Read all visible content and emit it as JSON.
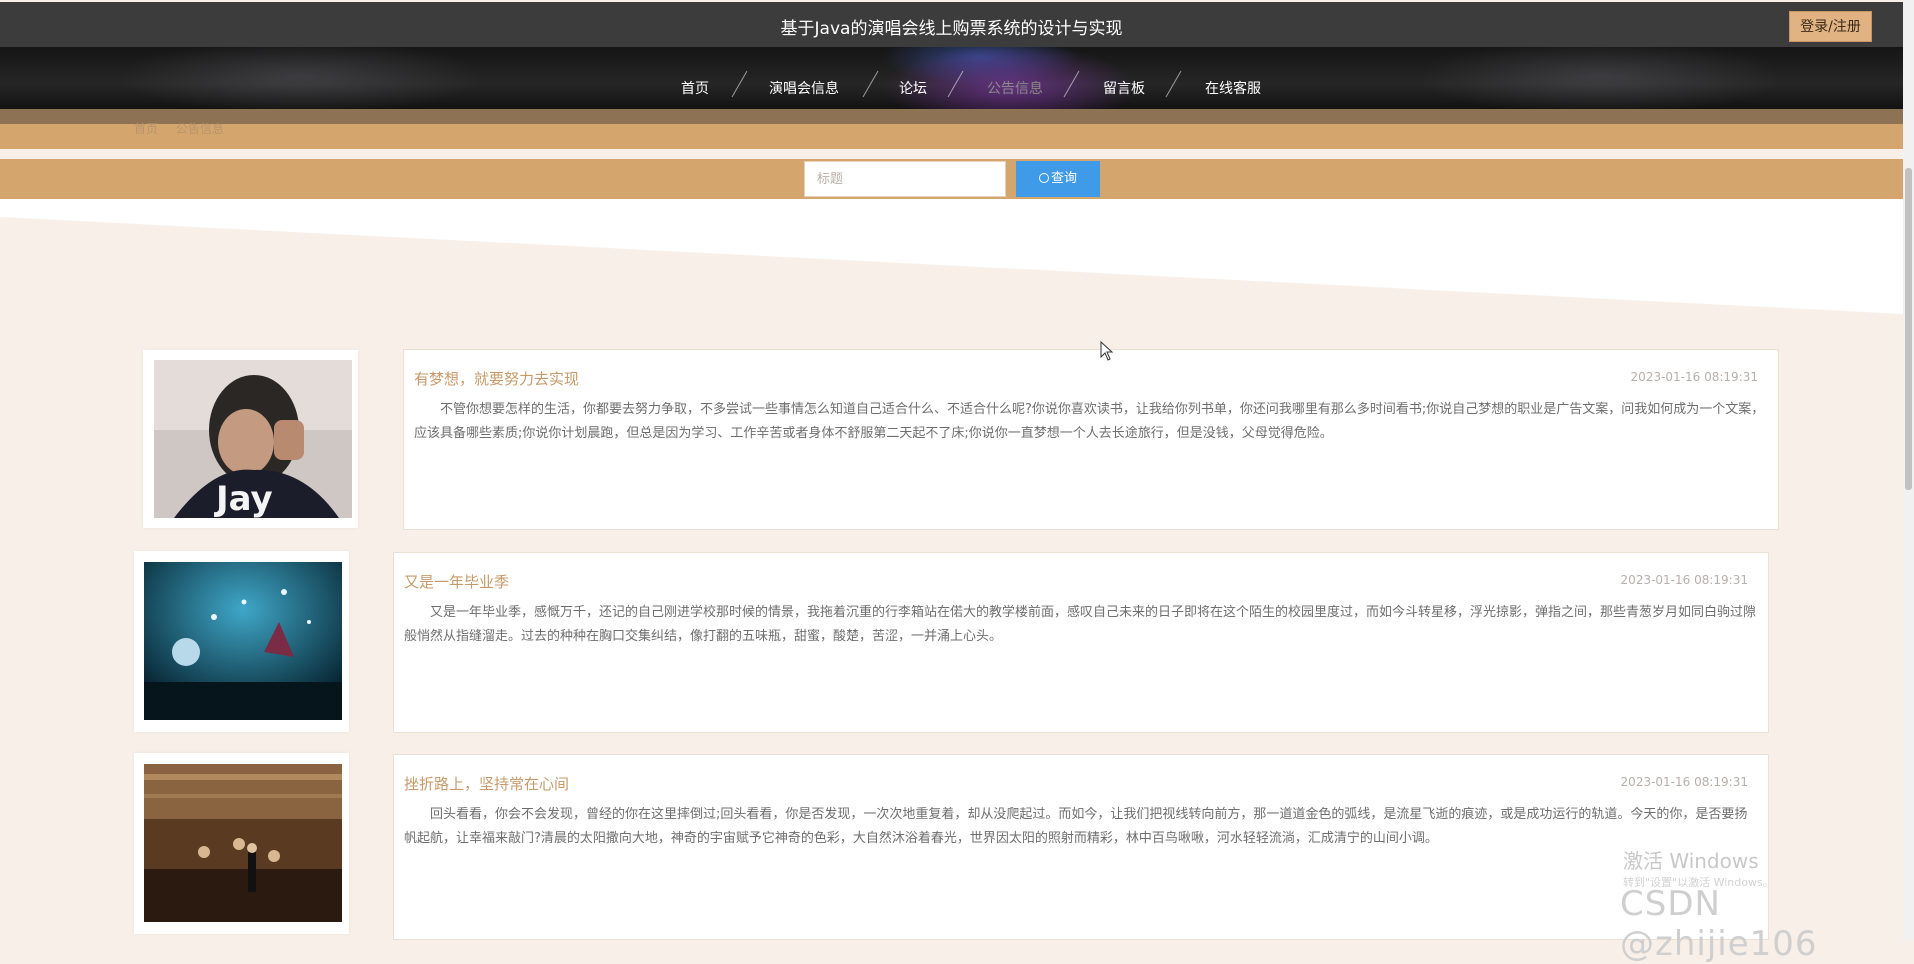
{
  "header": {
    "title": "基于Java的演唱会线上购票系统的设计与实现",
    "login_label": "登录/注册"
  },
  "nav": {
    "items": [
      {
        "label": "首页",
        "active": false
      },
      {
        "label": "演唱会信息",
        "active": false
      },
      {
        "label": "论坛",
        "active": false
      },
      {
        "label": "公告信息",
        "active": true
      },
      {
        "label": "留言板",
        "active": false
      },
      {
        "label": "在线客服",
        "active": false
      }
    ]
  },
  "breadcrumb": {
    "home": "首页",
    "current": "公告信息"
  },
  "search": {
    "placeholder": "标题",
    "button_label": "查询"
  },
  "articles": [
    {
      "title": "有梦想，就要努力去实现",
      "date": "2023-01-16 08:19:31",
      "image": "jay-portrait",
      "text": "不管你想要怎样的生活，你都要去努力争取，不多尝试一些事情怎么知道自己适合什么、不适合什么呢?你说你喜欢读书，让我给你列书单，你还问我哪里有那么多时间看书;你说自己梦想的职业是广告文案，问我如何成为一个文案，应该具备哪些素质;你说你计划晨跑，但总是因为学习、工作辛苦或者身体不舒服第二天起不了床;你说你一直梦想一个人去长途旅行，但是没钱，父母觉得危险。"
    },
    {
      "title": "又是一年毕业季",
      "date": "2023-01-16 08:19:31",
      "image": "concert-stage",
      "text": "又是一年毕业季，感慨万千，还记的自己刚进学校那时候的情景，我拖着沉重的行李箱站在偌大的教学楼前面，感叹自己未来的日子即将在这个陌生的校园里度过，而如今斗转星移，浮光掠影，弹指之间，那些青葱岁月如同白驹过隙般悄然从指缝溜走。过去的种种在胸口交集纠结，像打翻的五味瓶，甜蜜，酸楚，苦涩，一并涌上心头。"
    },
    {
      "title": "挫折路上，坚持常在心间",
      "date": "2023-01-16 08:19:31",
      "image": "orchestra-hall",
      "text": "回头看看，你会不会发现，曾经的你在这里摔倒过;回头看看，你是否发现，一次次地重复着，却从没爬起过。而如今，让我们把视线转向前方，那一道道金色的弧线，是流星飞逝的痕迹，或是成功运行的轨道。今天的你，是否要扬帆起航，让幸福来敲门?清晨的太阳撒向大地，神奇的宇宙赋予它神奇的色彩，大自然沐浴着春光，世界因太阳的照射而精彩，林中百鸟啾啾，河水轻轻流淌，汇成清宁的山间小调。"
    }
  ],
  "overlay": {
    "activate_windows": "激活 Windows",
    "activate_hint": "转到\"设置\"以激活 Windows。",
    "csdn_watermark": "CSDN @zhijie106"
  },
  "colors": {
    "accent_tan": "#d4a66e",
    "search_blue": "#3f9ae8",
    "title_gold": "#c79a6a"
  }
}
